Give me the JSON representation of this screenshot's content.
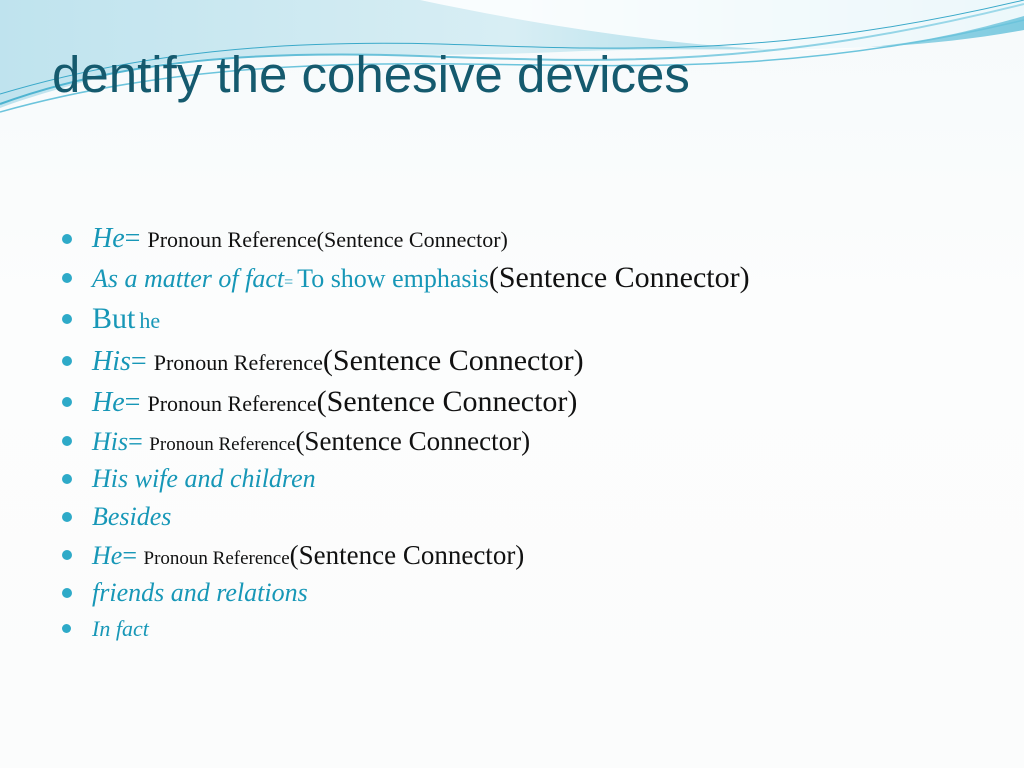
{
  "slide": {
    "title": "dentify the cohesive devices",
    "accent_color": "#1797b7",
    "title_color": "#155a6e",
    "bullet_color": "#2eaac8"
  },
  "bullets": [
    {
      "key": "He",
      "eq": "= ",
      "ref": "Pronoun Reference(Sentence Connector)",
      "conn": ""
    },
    {
      "key": "As a matter of fact",
      "eq": "= ",
      "ref": "To show emphasis",
      "conn": "(Sentence Connector)"
    },
    {
      "key": "But",
      "eq": " ",
      "ref": "he",
      "conn": ""
    },
    {
      "key": "His",
      "eq": "= ",
      "ref": "Pronoun Reference",
      "conn": "(Sentence Connector)"
    },
    {
      "key": "He",
      "eq": "= ",
      "ref": "Pronoun Reference",
      "conn": "(Sentence Connector)"
    },
    {
      "key": "His",
      "eq": "= ",
      "ref": "Pronoun Reference",
      "conn": "(Sentence Connector)"
    },
    {
      "key": "His wife and children",
      "eq": "",
      "ref": "",
      "conn": ""
    },
    {
      "key": "Besides",
      "eq": "",
      "ref": "",
      "conn": ""
    },
    {
      "key": "He",
      "eq": "= ",
      "ref": "Pronoun Reference",
      "conn": "(Sentence Connector)"
    },
    {
      "key": "friends and relations",
      "eq": "",
      "ref": "",
      "conn": ""
    },
    {
      "key": "In fact",
      "eq": "",
      "ref": "",
      "conn": ""
    }
  ]
}
